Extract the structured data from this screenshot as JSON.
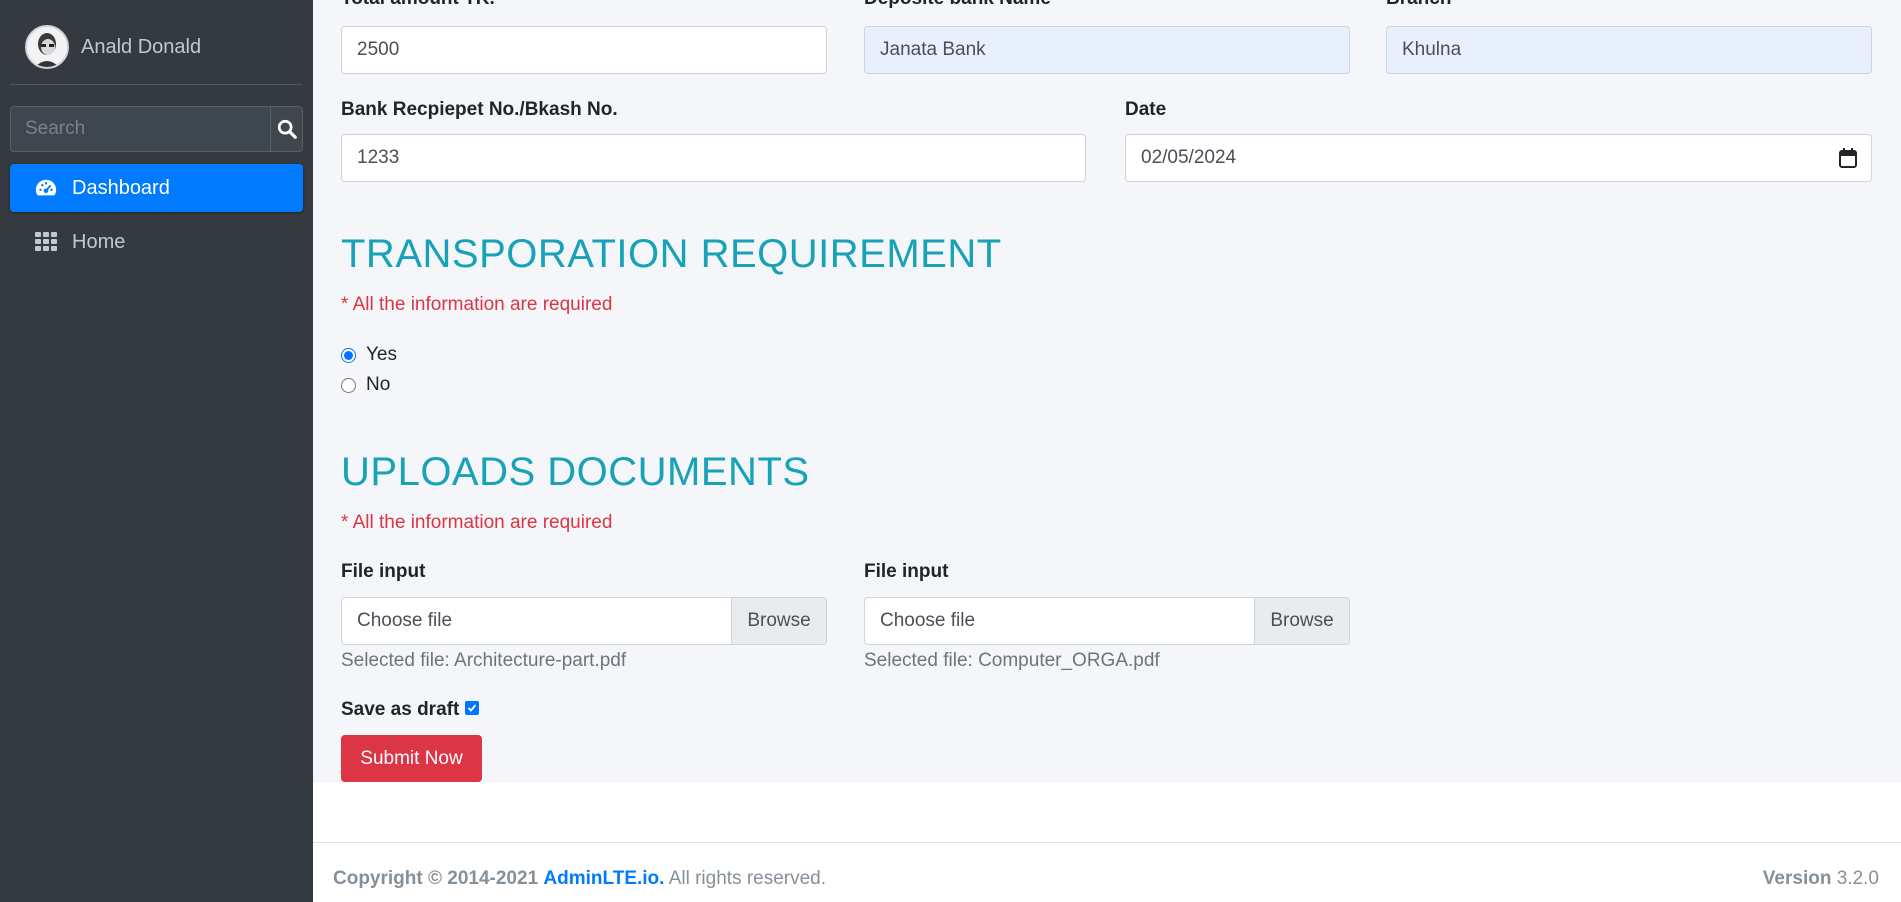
{
  "sidebar": {
    "user_name": "Anald Donald",
    "search_placeholder": "Search",
    "items": [
      {
        "label": "Dashboard",
        "icon": "tachometer-icon",
        "active": true
      },
      {
        "label": "Home",
        "icon": "grid-icon",
        "active": false
      }
    ]
  },
  "payment": {
    "total_amount_label": "Total amount TK.",
    "total_amount_value": "2500",
    "bank_name_label": "Deposite bank Name",
    "bank_name_value": "Janata Bank",
    "branch_label": "Branch",
    "branch_value": "Khulna",
    "receipt_label": "Bank Recpiepet No./Bkash No.",
    "receipt_value": "1233",
    "date_label": "Date",
    "date_value": "02/05/2024"
  },
  "transport": {
    "title": "TRANSPORATION REQUIREMENT",
    "required_note": "* All the information are required",
    "options": [
      {
        "label": "Yes",
        "checked": true
      },
      {
        "label": "No",
        "checked": false
      }
    ]
  },
  "uploads": {
    "title": "UPLOADS DOCUMENTS",
    "required_note": "* All the information are required",
    "files": [
      {
        "label": "File input",
        "placeholder": "Choose file",
        "browse": "Browse",
        "selected": "Selected file: Architecture-part.pdf"
      },
      {
        "label": "File input",
        "placeholder": "Choose file",
        "browse": "Browse",
        "selected": "Selected file: Computer_ORGA.pdf"
      }
    ],
    "save_draft_label": "Save as draft",
    "save_draft_checked": true,
    "submit_label": "Submit Now"
  },
  "footer": {
    "copyright": "Copyright © 2014-2021",
    "brand": "AdminLTE.io.",
    "rights": "All rights reserved.",
    "version_label": "Version",
    "version_value": "3.2.0"
  },
  "colors": {
    "accent": "#007bff",
    "section_title": "#17a2b8",
    "danger": "#dc3545",
    "sidebar_bg": "#343a40"
  }
}
